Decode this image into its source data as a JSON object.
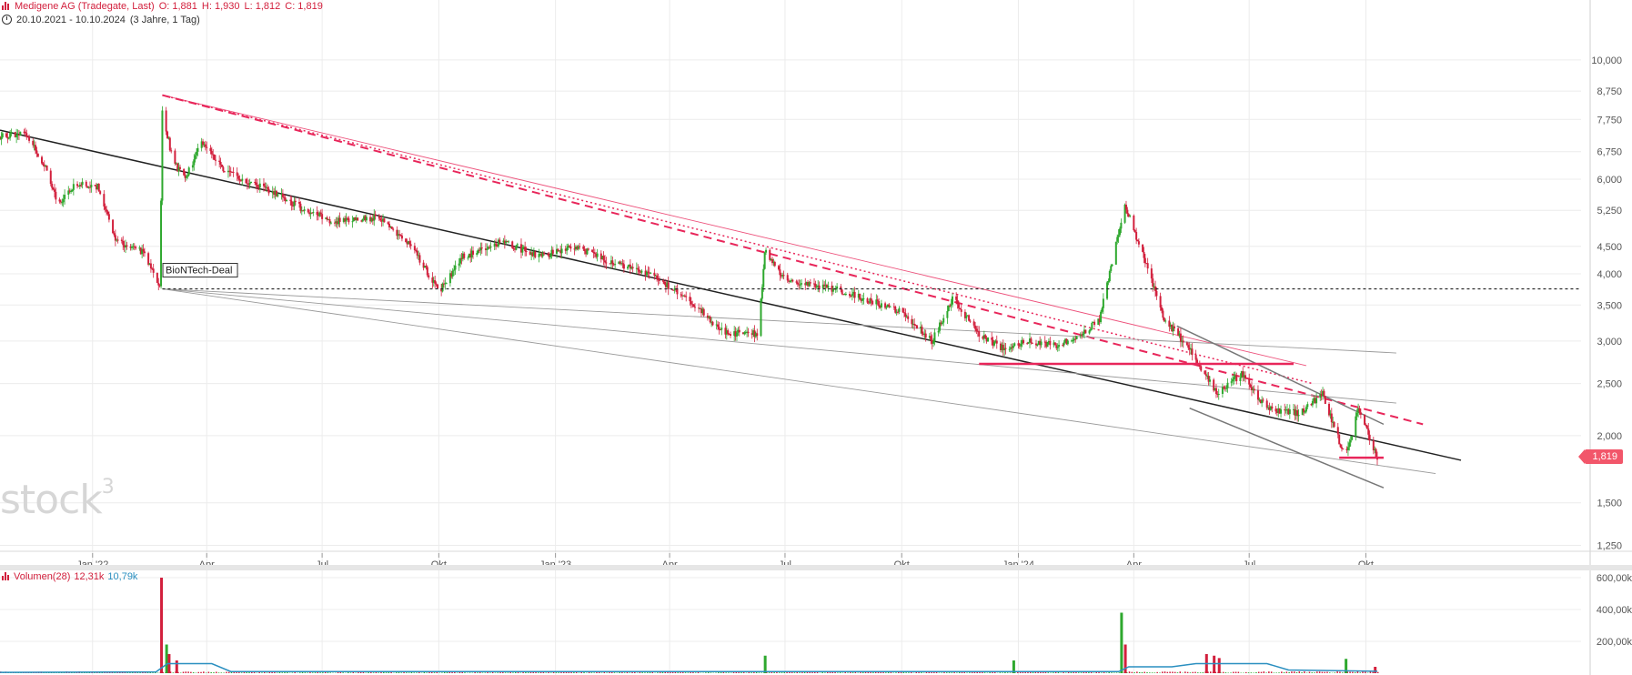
{
  "header": {
    "instrument": "Medigene AG (Tradegate, Last)",
    "open": "O: 1,881",
    "high": "H: 1,930",
    "low": "L: 1,812",
    "close": "C: 1,819",
    "range": "20.10.2021 - 10.10.2024",
    "period": "(3 Jahre, 1 Tag)"
  },
  "current_price_label": "1,819",
  "watermark": "stock",
  "watermark_sup": "3",
  "annotation": "BioNTech-Deal",
  "volume_legend": {
    "name": "Volumen(28)",
    "value": "12,31k",
    "avg": "10,79k"
  },
  "colors": {
    "up": "#2ea82e",
    "down": "#d21f3c",
    "pink": "#e8265a",
    "trend": "#222222",
    "grey": "#9a9a9a",
    "volume_avg": "#2a8fc0",
    "price_tag": "#f2566a"
  },
  "chart_data": {
    "type": "candlestick",
    "title": "Medigene AG (Tradegate, Last)",
    "y_scale": "log",
    "ylim": [
      1.2,
      11.5
    ],
    "y_ticks": [
      10.0,
      8.75,
      7.75,
      6.75,
      6.0,
      5.25,
      4.5,
      4.0,
      3.5,
      3.0,
      2.5,
      2.0,
      1.5,
      1.25
    ],
    "y_tick_labels": [
      "10,000",
      "8,750",
      "7,750",
      "6,750",
      "6,000",
      "5,250",
      "4,500",
      "4,000",
      "3,500",
      "3,000",
      "2,500",
      "2,000",
      "1,500",
      "1,250"
    ],
    "x_range": [
      "2021-10-20",
      "2024-10-10"
    ],
    "x_ticks": [
      "2022-01-01",
      "2022-04-01",
      "2022-07-01",
      "2022-10-01",
      "2023-01-01",
      "2023-04-01",
      "2023-07-01",
      "2023-10-01",
      "2024-01-01",
      "2024-04-01",
      "2024-07-01",
      "2024-10-01"
    ],
    "x_tick_labels": [
      "Jan '22",
      "Apr",
      "Jul",
      "Okt",
      "Jan '23",
      "Apr",
      "Jul",
      "Okt",
      "Jan '24",
      "Apr",
      "Jul",
      "Okt"
    ],
    "grid": true,
    "last": 1.819,
    "price_path": [
      [
        "2021-10-20",
        7.2
      ],
      [
        "2021-11-10",
        7.3
      ],
      [
        "2021-11-25",
        6.3
      ],
      [
        "2021-12-05",
        5.4
      ],
      [
        "2021-12-20",
        5.9
      ],
      [
        "2022-01-05",
        5.8
      ],
      [
        "2022-01-20",
        4.6
      ],
      [
        "2022-02-10",
        4.4
      ],
      [
        "2022-02-23",
        3.8
      ],
      [
        "2022-02-25",
        8.1
      ],
      [
        "2022-03-05",
        6.5
      ],
      [
        "2022-03-15",
        6.0
      ],
      [
        "2022-03-28",
        7.0
      ],
      [
        "2022-04-15",
        6.2
      ],
      [
        "2022-05-15",
        5.8
      ],
      [
        "2022-06-15",
        5.3
      ],
      [
        "2022-07-10",
        5.0
      ],
      [
        "2022-08-15",
        5.1
      ],
      [
        "2022-09-10",
        4.5
      ],
      [
        "2022-10-01",
        3.7
      ],
      [
        "2022-10-20",
        4.3
      ],
      [
        "2022-11-20",
        4.6
      ],
      [
        "2022-12-20",
        4.3
      ],
      [
        "2023-01-15",
        4.5
      ],
      [
        "2023-02-15",
        4.2
      ],
      [
        "2023-03-15",
        4.0
      ],
      [
        "2023-04-15",
        3.6
      ],
      [
        "2023-05-15",
        3.1
      ],
      [
        "2023-06-10",
        3.1
      ],
      [
        "2023-06-15",
        4.4
      ],
      [
        "2023-07-01",
        3.9
      ],
      [
        "2023-08-01",
        3.8
      ],
      [
        "2023-09-01",
        3.6
      ],
      [
        "2023-10-01",
        3.4
      ],
      [
        "2023-10-25",
        3.0
      ],
      [
        "2023-11-10",
        3.6
      ],
      [
        "2023-12-01",
        3.1
      ],
      [
        "2023-12-20",
        2.9
      ],
      [
        "2024-01-10",
        3.0
      ],
      [
        "2024-02-01",
        2.95
      ],
      [
        "2024-02-20",
        3.1
      ],
      [
        "2024-03-05",
        3.3
      ],
      [
        "2024-03-25",
        5.4
      ],
      [
        "2024-04-10",
        4.2
      ],
      [
        "2024-04-25",
        3.3
      ],
      [
        "2024-05-15",
        2.9
      ],
      [
        "2024-06-05",
        2.4
      ],
      [
        "2024-06-25",
        2.6
      ],
      [
        "2024-07-15",
        2.25
      ],
      [
        "2024-08-10",
        2.2
      ],
      [
        "2024-08-28",
        2.4
      ],
      [
        "2024-09-05",
        2.1
      ],
      [
        "2024-09-15",
        1.82
      ],
      [
        "2024-09-25",
        2.25
      ],
      [
        "2024-10-10",
        1.819
      ]
    ],
    "horizontal_levels": [
      {
        "value": 3.75,
        "style": "dotted",
        "color": "#222222"
      },
      {
        "value": 2.72,
        "from": "2023-12-01",
        "to": "2024-08-05",
        "color": "#e8265a"
      },
      {
        "value": 1.82,
        "from": "2024-09-10",
        "to": "2024-10-15",
        "color": "#e8265a"
      }
    ],
    "trendlines": [
      {
        "from": [
          "2021-10-20",
          7.4
        ],
        "to": [
          "2024-12-15",
          1.8
        ],
        "color": "#222222",
        "style": "solid"
      },
      {
        "from": [
          "2022-02-25",
          8.6
        ],
        "to": [
          "2024-11-15",
          2.1
        ],
        "color": "#e8265a",
        "style": "dashed"
      },
      {
        "from": [
          "2022-02-25",
          8.6
        ],
        "to": [
          "2024-08-15",
          2.7
        ],
        "color": "#e8265a",
        "style": "thin"
      },
      {
        "from": [
          "2022-02-25",
          8.6
        ],
        "to": [
          "2024-08-20",
          2.5
        ],
        "color": "#e8265a",
        "style": "dotted"
      },
      {
        "from": [
          "2022-02-25",
          3.75
        ],
        "to": [
          "2024-10-25",
          2.85
        ],
        "color": "#9a9a9a",
        "style": "thin"
      },
      {
        "from": [
          "2022-02-25",
          3.75
        ],
        "to": [
          "2024-10-25",
          2.3
        ],
        "color": "#9a9a9a",
        "style": "thin"
      },
      {
        "from": [
          "2022-02-25",
          3.75
        ],
        "to": [
          "2024-11-25",
          1.7
        ],
        "color": "#9a9a9a",
        "style": "thin"
      },
      {
        "from": [
          "2024-05-05",
          3.2
        ],
        "to": [
          "2024-10-15",
          2.1
        ],
        "color": "#777777",
        "style": "solid"
      },
      {
        "from": [
          "2024-05-15",
          2.25
        ],
        "to": [
          "2024-10-15",
          1.6
        ],
        "color": "#777777",
        "style": "solid"
      }
    ],
    "annotations": [
      {
        "date": "2022-02-24",
        "value": 3.9,
        "text": "BioNTech-Deal"
      }
    ],
    "volume": {
      "name": "Volumen(28)",
      "y_ticks": [
        200000,
        400000,
        600000
      ],
      "y_tick_labels": [
        "200,00k",
        "400,00k",
        "600,00k"
      ],
      "ylim": [
        0,
        640000
      ],
      "spikes": [
        [
          "2022-02-24",
          600000,
          "down"
        ],
        [
          "2022-02-28",
          180000,
          "up"
        ],
        [
          "2022-03-02",
          120000,
          "down"
        ],
        [
          "2022-03-08",
          80000,
          "down"
        ],
        [
          "2023-06-15",
          110000,
          "up"
        ],
        [
          "2023-12-28",
          80000,
          "up"
        ],
        [
          "2024-03-22",
          380000,
          "up"
        ],
        [
          "2024-03-25",
          180000,
          "down"
        ],
        [
          "2024-05-28",
          120000,
          "down"
        ],
        [
          "2024-06-03",
          110000,
          "down"
        ],
        [
          "2024-06-07",
          95000,
          "down"
        ],
        [
          "2024-09-15",
          90000,
          "up"
        ],
        [
          "2024-10-08",
          40000,
          "down"
        ]
      ],
      "avg_path": [
        [
          "2021-10-20",
          5000
        ],
        [
          "2022-02-20",
          8000
        ],
        [
          "2022-03-01",
          60000
        ],
        [
          "2022-04-05",
          60000
        ],
        [
          "2022-04-20",
          10000
        ],
        [
          "2024-03-20",
          10000
        ],
        [
          "2024-03-28",
          40000
        ],
        [
          "2024-05-01",
          40000
        ],
        [
          "2024-05-20",
          60000
        ],
        [
          "2024-07-15",
          60000
        ],
        [
          "2024-08-01",
          20000
        ],
        [
          "2024-10-10",
          12310
        ]
      ]
    }
  }
}
